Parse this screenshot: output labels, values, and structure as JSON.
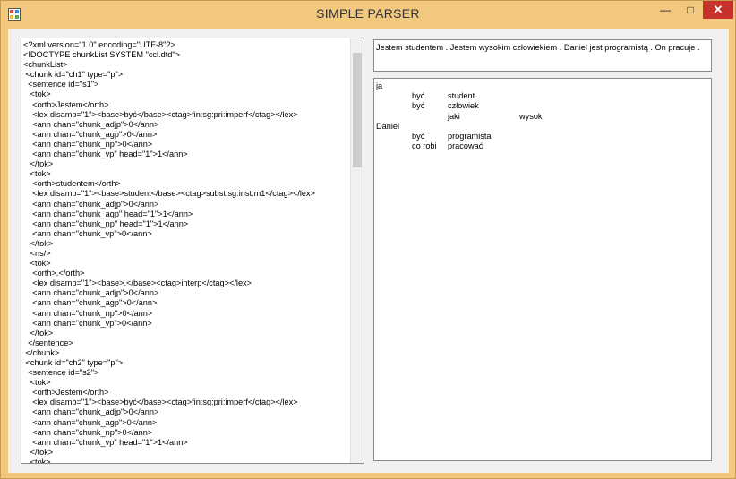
{
  "window": {
    "title": "SIMPLE PARSER",
    "icon": "app-window-icon",
    "controls": {
      "minimize": "—",
      "maximize": "□",
      "close": "✕"
    }
  },
  "xml_editor": {
    "lines": [
      "<?xml version=\"1.0\" encoding=\"UTF-8\"?>",
      "<!DOCTYPE chunkList SYSTEM \"ccl.dtd\">",
      "<chunkList>",
      " <chunk id=\"ch1\" type=\"p\">",
      "  <sentence id=\"s1\">",
      "   <tok>",
      "    <orth>Jestem</orth>",
      "    <lex disamb=\"1\"><base>być</base><ctag>fin:sg:pri:imperf</ctag></lex>",
      "    <ann chan=\"chunk_adjp\">0</ann>",
      "    <ann chan=\"chunk_agp\">0</ann>",
      "    <ann chan=\"chunk_np\">0</ann>",
      "    <ann chan=\"chunk_vp\" head=\"1\">1</ann>",
      "   </tok>",
      "   <tok>",
      "    <orth>studentem</orth>",
      "    <lex disamb=\"1\"><base>student</base><ctag>subst:sg:inst:m1</ctag></lex>",
      "    <ann chan=\"chunk_adjp\">0</ann>",
      "    <ann chan=\"chunk_agp\" head=\"1\">1</ann>",
      "    <ann chan=\"chunk_np\" head=\"1\">1</ann>",
      "    <ann chan=\"chunk_vp\">0</ann>",
      "   </tok>",
      "   <ns/>",
      "   <tok>",
      "    <orth>.</orth>",
      "    <lex disamb=\"1\"><base>.</base><ctag>interp</ctag></lex>",
      "    <ann chan=\"chunk_adjp\">0</ann>",
      "    <ann chan=\"chunk_agp\">0</ann>",
      "    <ann chan=\"chunk_np\">0</ann>",
      "    <ann chan=\"chunk_vp\">0</ann>",
      "   </tok>",
      "  </sentence>",
      " </chunk>",
      " <chunk id=\"ch2\" type=\"p\">",
      "  <sentence id=\"s2\">",
      "   <tok>",
      "    <orth>Jestem</orth>",
      "    <lex disamb=\"1\"><base>być</base><ctag>fin:sg:pri:imperf</ctag></lex>",
      "    <ann chan=\"chunk_adjp\">0</ann>",
      "    <ann chan=\"chunk_agp\">0</ann>",
      "    <ann chan=\"chunk_np\">0</ann>",
      "    <ann chan=\"chunk_vp\" head=\"1\">1</ann>",
      "   </tok>",
      "   <tok>"
    ]
  },
  "sentence_box": {
    "text": "Jestem studentem . Jestem wysokim człowiekiem . Daniel jest programistą . On pracuje ."
  },
  "tree_box": {
    "rows": [
      {
        "c0": "ja",
        "c1": "",
        "c2": "",
        "c3": ""
      },
      {
        "c0": "",
        "c1": "być",
        "c2": "student",
        "c3": ""
      },
      {
        "c0": "",
        "c1": "być",
        "c2": "człowiek",
        "c3": ""
      },
      {
        "c0": "",
        "c1": "",
        "c2": "jaki",
        "c3": "wysoki"
      },
      {
        "c0": "Daniel",
        "c1": "",
        "c2": "",
        "c3": ""
      },
      {
        "c0": "",
        "c1": "być",
        "c2": "programista",
        "c3": ""
      },
      {
        "c0": "",
        "c1": "co robi",
        "c2": "pracować",
        "c3": ""
      }
    ]
  },
  "colors": {
    "frame": "#f2c77e",
    "close_button": "#c7312b",
    "client_bg": "#f0f0f0",
    "scroll_thumb": "#cdcdcd"
  }
}
